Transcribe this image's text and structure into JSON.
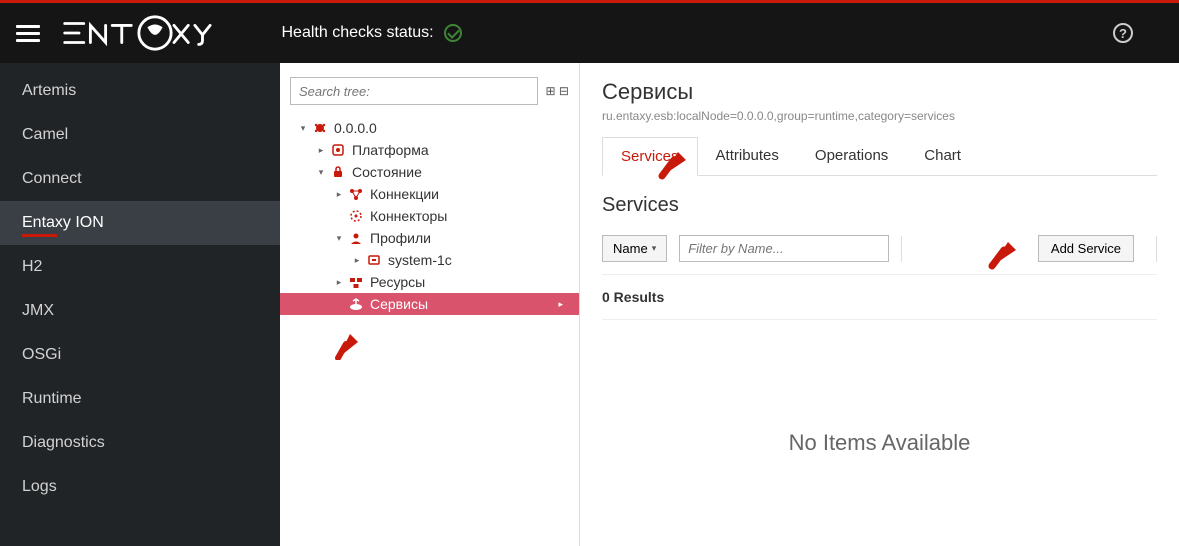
{
  "header": {
    "health_label": "Health checks status:"
  },
  "sidebar": {
    "items": [
      {
        "label": "Artemis"
      },
      {
        "label": "Camel"
      },
      {
        "label": "Connect"
      },
      {
        "label": "Entaxy ION"
      },
      {
        "label": "H2"
      },
      {
        "label": "JMX"
      },
      {
        "label": "OSGi"
      },
      {
        "label": "Runtime"
      },
      {
        "label": "Diagnostics"
      },
      {
        "label": "Logs"
      }
    ],
    "active_index": 3
  },
  "tree": {
    "search_placeholder": "Search tree:",
    "nodes": {
      "root": "0.0.0.0",
      "platform": "Платформа",
      "state": "Состояние",
      "connections": "Коннекции",
      "connectors": "Коннекторы",
      "profiles": "Профили",
      "system1c": "system-1c",
      "resources": "Ресурсы",
      "services": "Сервисы"
    }
  },
  "main": {
    "page_title": "Сервисы",
    "mbean": "ru.entaxy.esb:localNode=0.0.0.0,group=runtime,category=services",
    "tabs": [
      {
        "label": "Services"
      },
      {
        "label": "Attributes"
      },
      {
        "label": "Operations"
      },
      {
        "label": "Chart"
      }
    ],
    "active_tab": 0,
    "section_title": "Services",
    "filter": {
      "name_button": "Name",
      "placeholder": "Filter by Name...",
      "add_button": "Add Service"
    },
    "results_text": "0 Results",
    "empty_text": "No Items Available"
  }
}
